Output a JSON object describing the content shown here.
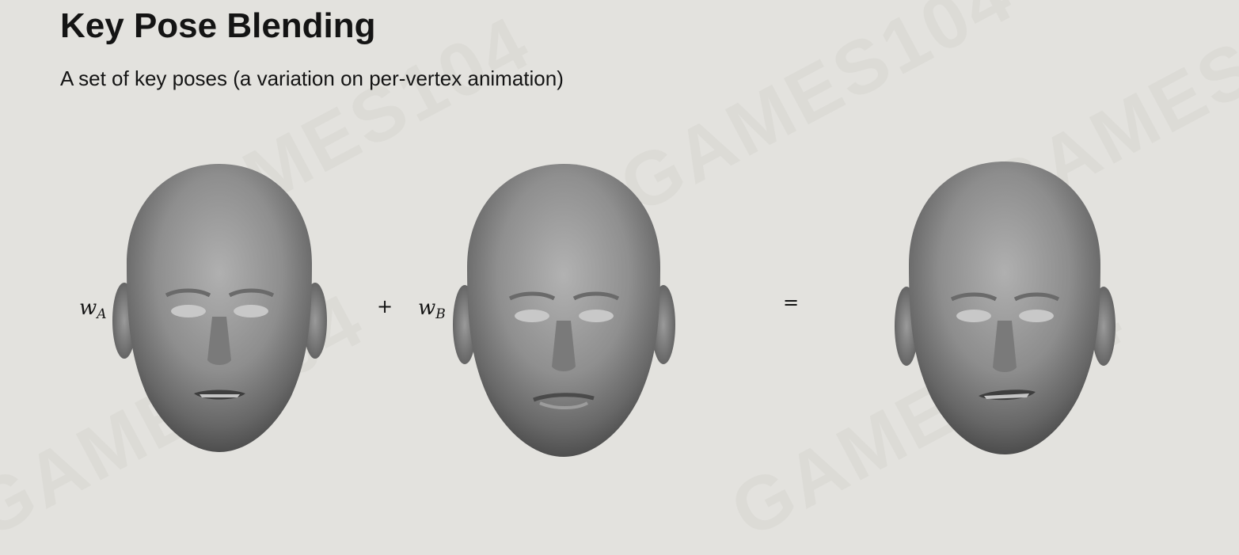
{
  "slide": {
    "title": "Key Pose Blending",
    "subtitle": "A set of key poses (a variation on per-vertex animation)"
  },
  "watermark": {
    "text": "GAMES104"
  },
  "equation": {
    "weight_a": {
      "symbol": "w",
      "subscript": "A"
    },
    "weight_b": {
      "symbol": "w",
      "subscript": "B"
    },
    "plus": "+",
    "equals": "=",
    "faces": [
      {
        "name": "key-pose-a",
        "expression": "mouth slightly open, teeth showing"
      },
      {
        "name": "key-pose-b",
        "expression": "mouth closed, neutral"
      },
      {
        "name": "blended-pose",
        "expression": "mouth slightly open, asymmetric blend"
      }
    ]
  },
  "colors": {
    "background": "#e3e2de",
    "text": "#141414",
    "skin_light": "#a6a6a6",
    "skin_dark": "#4a4a4a"
  }
}
